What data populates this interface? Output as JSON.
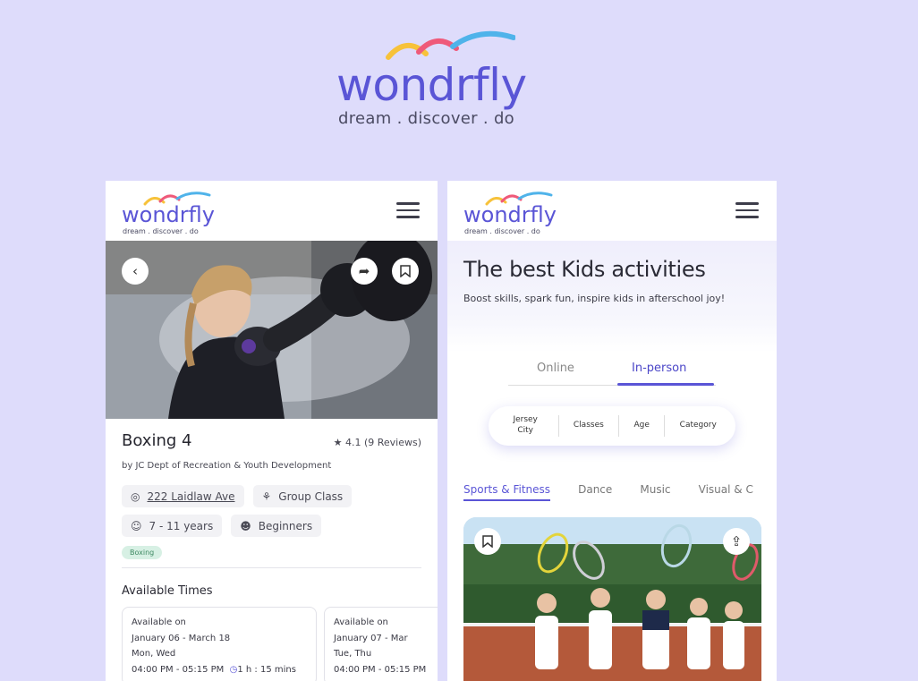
{
  "brand": {
    "name": "wondrfly",
    "tagline": "dream . discover . do",
    "colors": {
      "primary": "#5a55d6",
      "background": "#dedcfb",
      "arc_yellow": "#f7c23a",
      "arc_pink": "#ef5a7a",
      "arc_blue": "#4fb3ea"
    }
  },
  "left_phone": {
    "menu_icon": "hamburger-icon",
    "activity": {
      "title": "Boxing 4",
      "rating": "4.1 (9 Reviews)",
      "provider": "by JC Dept of Recreation & Youth Development",
      "address": "222 Laidlaw Ave",
      "class_type": "Group Class",
      "ages": "7 - 11 years",
      "level": "Beginners",
      "tag": "Boxing"
    },
    "available_times_title": "Available Times",
    "times": [
      {
        "label": "Available on",
        "dates": "January 06 - March 18",
        "days": "Mon, Wed",
        "hours": "04:00 PM - 05:15 PM",
        "duration": "1 h : 15 mins"
      },
      {
        "label": "Available on",
        "dates": "January 07 - Mar",
        "days": "Tue, Thu",
        "hours": "04:00 PM - 05:15 PM",
        "duration": ""
      }
    ]
  },
  "right_phone": {
    "headline": "The best Kids activities",
    "subtitle": "Boost skills, spark fun, inspire kids in afterschool joy!",
    "mode_tabs": {
      "online": "Online",
      "in_person": "In-person",
      "selected": "In-person"
    },
    "filters": [
      "Jersey City",
      "Classes",
      "Age",
      "Category"
    ],
    "categories": [
      "Sports & Fitness",
      "Dance",
      "Music",
      "Visual & C"
    ],
    "selected_category": "Sports & Fitness"
  }
}
